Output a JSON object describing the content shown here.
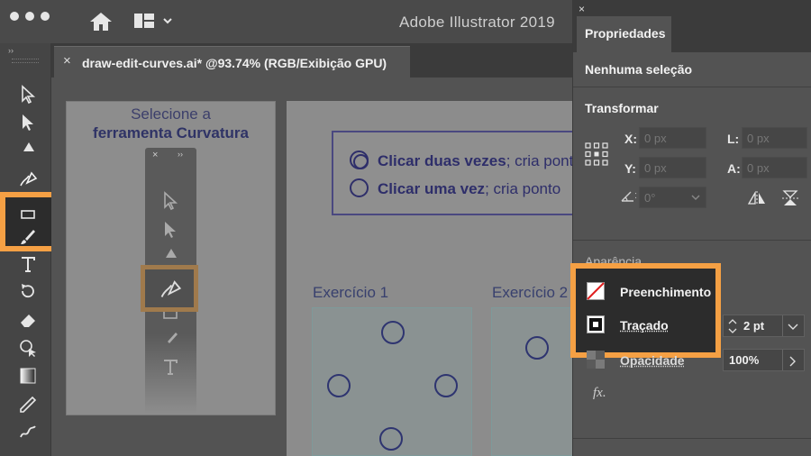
{
  "window": {
    "title": "Adobe Illustrator 2019",
    "icons": [
      "close-dot",
      "minimize-dot",
      "zoom-dot",
      "home-icon",
      "workspace-layout-icon",
      "chevron-down-icon"
    ]
  },
  "document_tab": {
    "close": "×",
    "title": "draw-edit-curves.ai* @93.74% (RGB/Exibição GPU)"
  },
  "toolbar": {
    "grip": "››",
    "tools": [
      "selection-tool",
      "direct-selection-tool",
      "pen-tool",
      "curvature-tool",
      "rectangle-tool",
      "paintbrush-tool",
      "type-tool",
      "rotate-tool",
      "eraser-tool",
      "shape-builder-tool",
      "gradient-tool",
      "eyedropper-tool",
      "blend-tool"
    ],
    "active_tool": "curvature-tool"
  },
  "canvas": {
    "instruction_line1": "Selecione a",
    "instruction_line2": "ferramenta Curvatura",
    "hint_double_bold": "Clicar duas vezes",
    "hint_double_rest": "; cria pont",
    "hint_single_bold": "Clicar uma vez",
    "hint_single_rest": "; cria ponto",
    "exercise1": "Exercício 1",
    "exercise2": "Exercício 2"
  },
  "properties": {
    "close": "×",
    "tab": "Propriedades",
    "no_selection": "Nenhuma seleção",
    "transform": {
      "title": "Transformar",
      "x_label": "X:",
      "y_label": "Y:",
      "w_label": "L:",
      "h_label": "A:",
      "x_value": "0 px",
      "y_value": "0 px",
      "w_value": "0 px",
      "h_value": "0 px",
      "angle_value": "0°"
    },
    "appearance": {
      "title": "Aparência",
      "fill_label": "Preenchimento",
      "stroke_label": "Traçado",
      "stroke_weight": "2 pt",
      "opacity_label": "Opacidade",
      "opacity_value": "100%",
      "fx": "fx."
    }
  },
  "colors": {
    "highlight": "#f5a044",
    "panel_bg": "#535353",
    "artboard_text": "#2e2e6a"
  }
}
